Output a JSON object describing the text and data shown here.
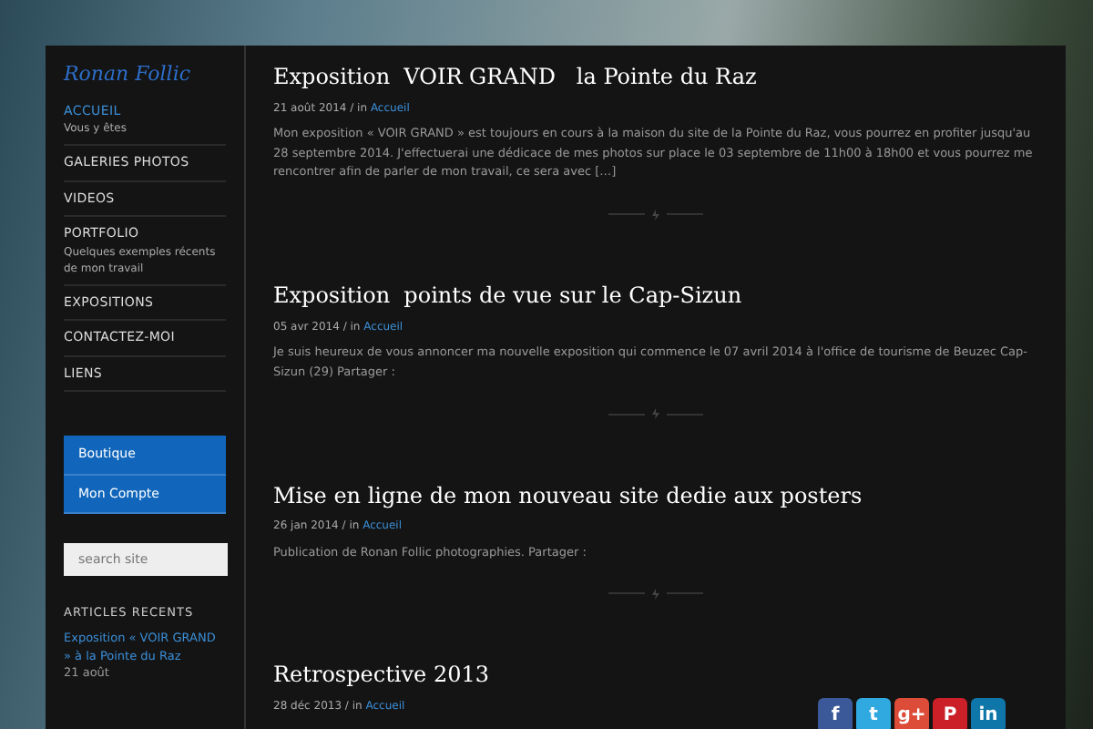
{
  "site": {
    "logo": "Ronan Follic"
  },
  "menu": [
    {
      "label": "ACCUEIL",
      "subtitle": "Vous y êtes",
      "selected": true
    },
    {
      "label": "GALERIES PHOTOS",
      "selected": false
    },
    {
      "label": "VIDEOS",
      "selected": false
    },
    {
      "label": "PORTFOLIO",
      "subtitle": "Quelques exemples récents de mon travail",
      "selected": false
    },
    {
      "label": "EXPOSITIONS",
      "selected": false
    },
    {
      "label": "CONTACTEZ-MOI",
      "selected": false
    },
    {
      "label": "LIENS",
      "selected": false
    }
  ],
  "shop_links": [
    "Boutique",
    "Mon Compte"
  ],
  "search": {
    "placeholder": "search site"
  },
  "recent_articles": {
    "heading": "ARTICLES RECENTS",
    "items": [
      {
        "link": "Exposition « VOIR GRAND » à la Pointe du Raz",
        "date": "21 août"
      }
    ]
  },
  "posts": [
    {
      "title": "Exposition  VOIR GRAND   la Pointe du Raz",
      "date": "21 août 2014",
      "in": "/ in",
      "category": "Accueil",
      "excerpt": "Mon exposition « VOIR GRAND » est toujours en cours à la maison du site de la Pointe du Raz, vous pourrez en profiter jusqu'au 28 septembre 2014. J'effectuerai une dédicace de mes photos sur place le 03 septembre de 11h00 à 18h00 et vous pourrez me rencontrer afin de parler de mon travail, ce sera avec […]"
    },
    {
      "title": "Exposition  points de vue sur le Cap-Sizun",
      "date": "05 avr 2014",
      "in": "/ in",
      "category": "Accueil",
      "excerpt": "Je suis heureux de vous annoncer ma nouvelle exposition qui commence le 07 avril 2014 à l'office de tourisme de Beuzec Cap-Sizun (29) Partager :"
    },
    {
      "title": "Mise en ligne de mon nouveau site dedie aux posters",
      "date": "26 jan 2014",
      "in": "/ in",
      "category": "Accueil",
      "excerpt": "Publication de Ronan Follic photographies. Partager :"
    },
    {
      "title": "Retrospective 2013",
      "date": "28 déc 2013",
      "in": "/ in",
      "category": "Accueil"
    }
  ],
  "share_buttons": [
    {
      "kind": "facebook",
      "label": "f"
    },
    {
      "kind": "twitter",
      "label": "t"
    },
    {
      "kind": "google",
      "label": "g+"
    },
    {
      "kind": "pinterest",
      "label": "P"
    },
    {
      "kind": "linkedin",
      "label": "in"
    }
  ]
}
